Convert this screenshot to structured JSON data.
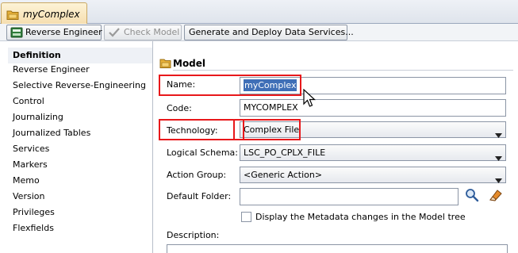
{
  "window": {
    "tab_title": "myComplex",
    "tab_icon": "model-folder-icon"
  },
  "toolbar": {
    "reverse_engineer": "Reverse Engineer",
    "check_model": "Check Model",
    "generate_deploy": "Generate and Deploy Data Services..."
  },
  "nav": {
    "items": [
      {
        "label": "Definition",
        "selected": true
      },
      {
        "label": "Reverse Engineer"
      },
      {
        "label": "Selective Reverse-Engineering"
      },
      {
        "label": "Control"
      },
      {
        "label": "Journalizing"
      },
      {
        "label": "Journalized Tables"
      },
      {
        "label": "Services"
      },
      {
        "label": "Markers"
      },
      {
        "label": "Memo"
      },
      {
        "label": "Version"
      },
      {
        "label": "Privileges"
      },
      {
        "label": "Flexfields"
      }
    ]
  },
  "form": {
    "section_title": "Model",
    "name_label": "Name:",
    "name_value": "myComplex",
    "code_label": "Code:",
    "code_value": "MYCOMPLEX",
    "technology_label": "Technology:",
    "technology_value": "Complex File",
    "logical_schema_label": "Logical Schema:",
    "logical_schema_value": "LSC_PO_CPLX_FILE",
    "action_group_label": "Action Group:",
    "action_group_value": "<Generic Action>",
    "default_folder_label": "Default Folder:",
    "default_folder_value": "",
    "display_metadata_label": "Display the Metadata changes in the Model tree",
    "display_metadata_checked": false,
    "description_label": "Description:"
  },
  "colors": {
    "highlight_box": "#e8181b",
    "selection": "#3f6fb7"
  }
}
